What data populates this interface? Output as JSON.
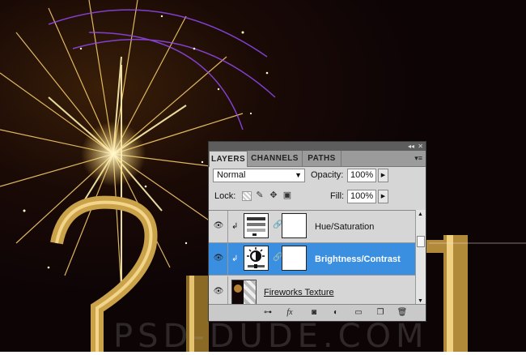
{
  "panel": {
    "tabs": [
      {
        "label": "LAYERS",
        "active": true
      },
      {
        "label": "CHANNELS",
        "active": false
      },
      {
        "label": "PATHS",
        "active": false
      }
    ],
    "blend_mode": "Normal",
    "opacity_label": "Opacity:",
    "opacity_value": "100%",
    "lock_label": "Lock:",
    "fill_label": "Fill:",
    "fill_value": "100%",
    "layers": [
      {
        "name": "Hue/Saturation",
        "selected": false,
        "icon": "hue-saturation-adjustment-icon"
      },
      {
        "name": "Brightness/Contrast",
        "selected": true,
        "icon": "brightness-contrast-adjustment-icon"
      },
      {
        "name": "Fireworks Texture",
        "selected": false,
        "icon": "image-thumbnail"
      }
    ],
    "bottom_icons": [
      "link-layers-icon",
      "fx-icon",
      "add-mask-icon",
      "adjustment-layer-icon",
      "group-folder-icon",
      "new-layer-icon",
      "trash-icon"
    ],
    "fx_label": "fx"
  },
  "background": {
    "watermark": "PSD-DUDE.COM"
  },
  "colors": {
    "selection": "#3b8fe0",
    "panel": "#d6d6d6"
  }
}
